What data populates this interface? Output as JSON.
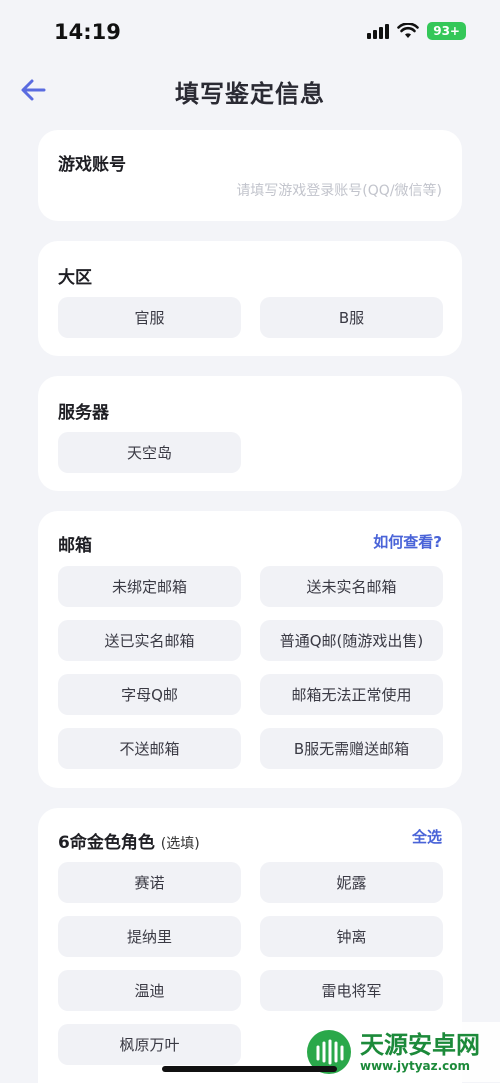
{
  "status_bar": {
    "time": "14:19",
    "battery": "93+"
  },
  "header": {
    "title": "填写鉴定信息"
  },
  "account": {
    "label": "游戏账号",
    "placeholder": "请填写游戏登录账号(QQ/微信等)"
  },
  "region": {
    "label": "大区",
    "options": [
      "官服",
      "B服"
    ]
  },
  "server": {
    "label": "服务器",
    "options": [
      "天空岛"
    ]
  },
  "mailbox": {
    "label": "邮箱",
    "help_link": "如何查看?",
    "options": [
      "未绑定邮箱",
      "送未实名邮箱",
      "送已实名邮箱",
      "普通Q邮(随游戏出售)",
      "字母Q邮",
      "邮箱无法正常使用",
      "不送邮箱",
      "B服无需赠送邮箱"
    ]
  },
  "characters": {
    "label": "6命金色角色",
    "hint": "(选填)",
    "select_all": "全选",
    "options": [
      "赛诺",
      "妮露",
      "提纳里",
      "钟离",
      "温迪",
      "雷电将军",
      "枫原万叶"
    ]
  },
  "watermark": {
    "name": "天源安卓网",
    "url": "www.jytyaz.com"
  }
}
